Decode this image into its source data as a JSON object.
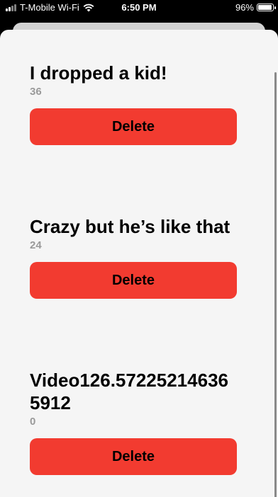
{
  "status_bar": {
    "carrier": "T-Mobile Wi-Fi",
    "time": "6:50 PM",
    "battery": "96%",
    "battery_level": 0.96
  },
  "entries": [
    {
      "title": "I dropped a kid!",
      "count": "36",
      "delete_label": "Delete"
    },
    {
      "title": "Crazy but he’s like that",
      "count": "24",
      "delete_label": "Delete"
    },
    {
      "title": "Video126.572252146365912",
      "count": "0",
      "delete_label": "Delete"
    }
  ],
  "colors": {
    "delete_button": "#f23b30",
    "sheet_background": "#f5f5f5",
    "count_text": "#9a9a9a"
  }
}
